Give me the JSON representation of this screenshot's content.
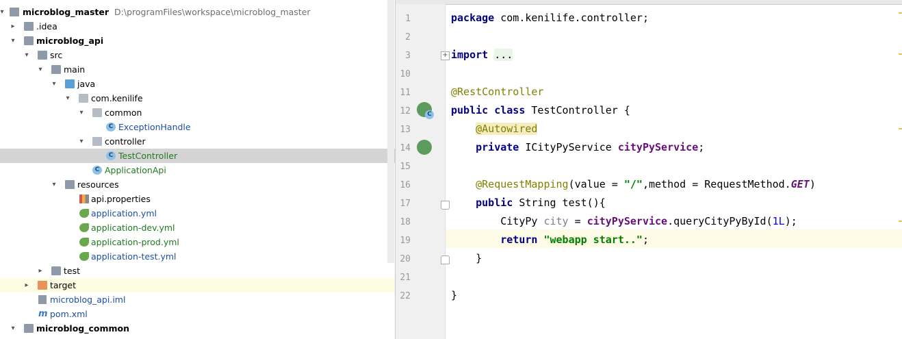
{
  "project_tree": {
    "root": {
      "label": "microblog_master",
      "path": "D:\\programFiles\\workspace\\microblog_master"
    },
    "items": [
      {
        "label": "microblog_master"
      },
      {
        "label": ".idea"
      },
      {
        "label": "microblog_api"
      },
      {
        "label": "src"
      },
      {
        "label": "main"
      },
      {
        "label": "java"
      },
      {
        "label": "com.kenilife"
      },
      {
        "label": "common"
      },
      {
        "label": "ExceptionHandle"
      },
      {
        "label": "controller"
      },
      {
        "label": "TestController"
      },
      {
        "label": "ApplicationApi"
      },
      {
        "label": "resources"
      },
      {
        "label": "api.properties"
      },
      {
        "label": "application.yml"
      },
      {
        "label": "application-dev.yml"
      },
      {
        "label": "application-prod.yml"
      },
      {
        "label": "application-test.yml"
      },
      {
        "label": "test"
      },
      {
        "label": "target"
      },
      {
        "label": "microblog_api.iml"
      },
      {
        "label": "pom.xml"
      },
      {
        "label": "microblog_common"
      }
    ]
  },
  "editor": {
    "line_numbers": [
      "1",
      "2",
      "3",
      "10",
      "11",
      "12",
      "13",
      "14",
      "15",
      "16",
      "17",
      "18",
      "19",
      "20",
      "21",
      "22"
    ],
    "tokens": {
      "package_kw": "package",
      "package_name": "com.kenilife.controller;",
      "import_kw": "import",
      "import_fold": "...",
      "rest_controller": "@RestController",
      "public_kw": "public",
      "class_kw": "class",
      "class_name": "TestController {",
      "autowired": "@Autowired",
      "private_kw": "private",
      "field_type": "ICityPyService",
      "field_name": "cityPyService",
      "semicolon": ";",
      "request_mapping": "@RequestMapping",
      "rm_args_1": "(value = ",
      "rm_value": "\"/\"",
      "rm_args_2": ",method = RequestMethod.",
      "rm_get": "GET",
      "rm_close": ")",
      "method_public": "public",
      "method_sig": "String test(){",
      "local_type": "CityPy",
      "local_var": "city",
      "assign": " = ",
      "call_field": "cityPyService",
      "call_method": ".queryCityPyById(",
      "call_arg": "1L",
      "call_close": ");",
      "return_kw": "return",
      "return_str": "\"webapp start..\"",
      "return_semi": ";",
      "close_method": "}",
      "close_class": "}"
    }
  },
  "colors": {
    "keyword": "#000080",
    "annotation": "#808000",
    "field": "#660e7a",
    "string": "#008000",
    "number": "#0000ff",
    "selection": "#d4d4d4",
    "current_line": "#fdfbe6"
  }
}
